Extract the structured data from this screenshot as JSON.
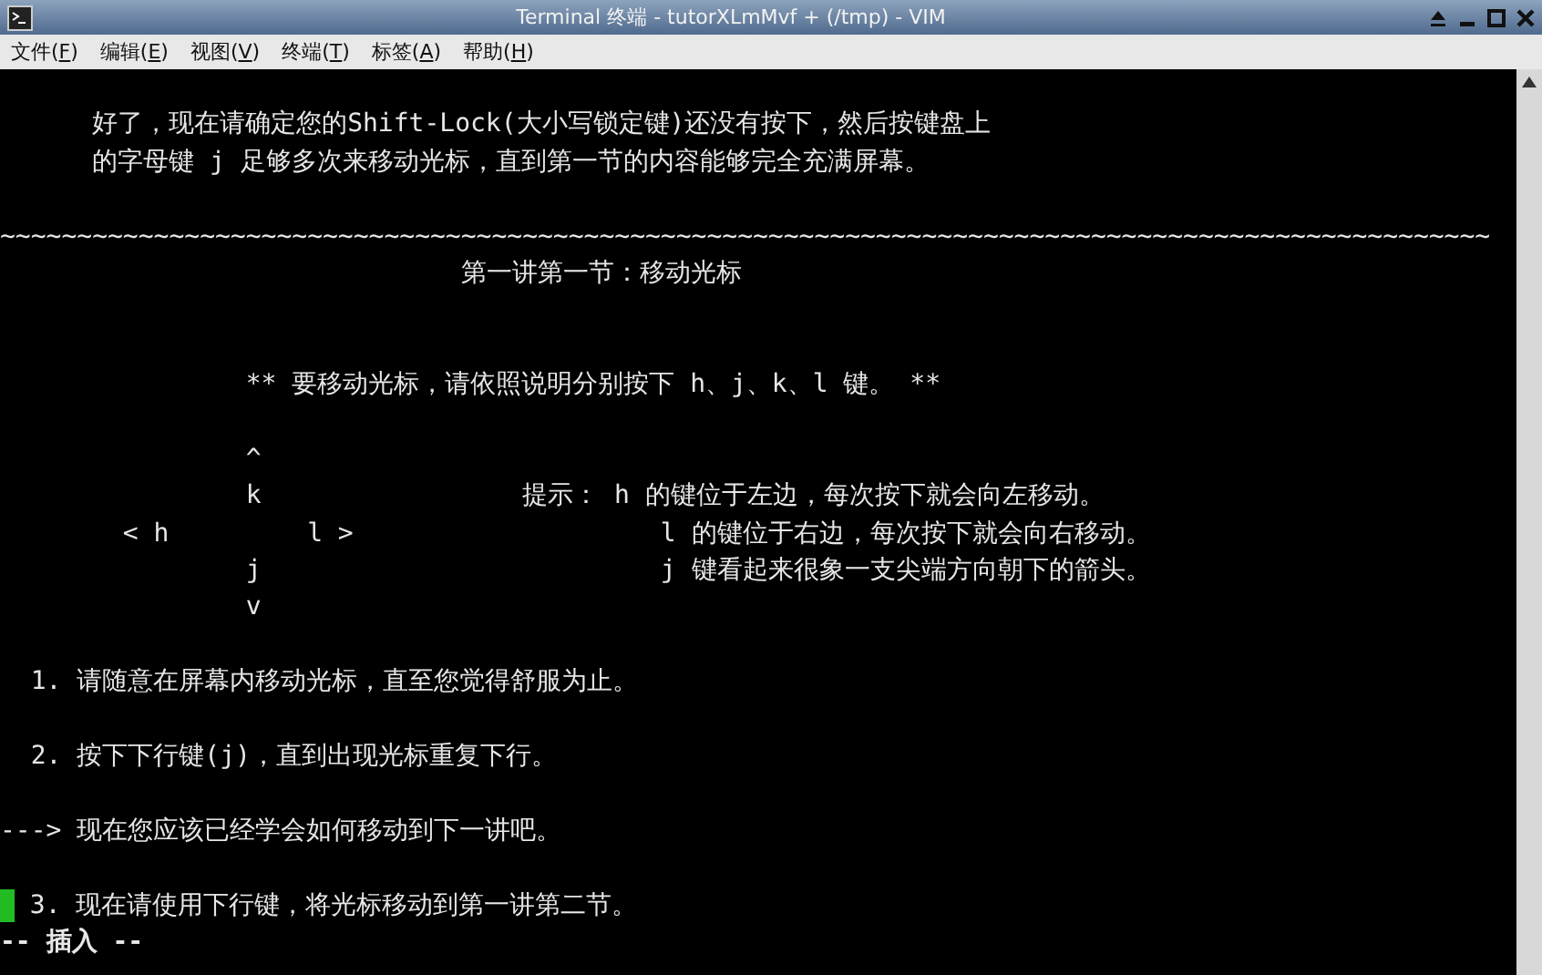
{
  "window": {
    "title": "Terminal 终端 - tutorXLmMvf + (/tmp) - VIM"
  },
  "menu": [
    "文件(F)",
    "编辑(E)",
    "视图(V)",
    "终端(T)",
    "标签(A)",
    "帮助(H)"
  ],
  "terminal": {
    "lines": [
      {
        "kind": "blank"
      },
      {
        "kind": "text",
        "text": "      好了，现在请确定您的Shift-Lock(大小写锁定键)还没有按下，然后按键盘上"
      },
      {
        "kind": "text",
        "text": "      的字母键 j 足够多次来移动光标，直到第一节的内容能够完全充满屏幕。"
      },
      {
        "kind": "blank"
      },
      {
        "kind": "text",
        "text": "~~~~~~~~~~~~~~~~~~~~~~~~~~~~~~~~~~~~~~~~~~~~~~~~~~~~~~~~~~~~~~~~~~~~~~~~~~~~~~~~~~~~~~~~~~~~~~~~~"
      },
      {
        "kind": "text",
        "text": "                              第一讲第一节：移动光标"
      },
      {
        "kind": "blank"
      },
      {
        "kind": "blank"
      },
      {
        "kind": "text",
        "text": "                ** 要移动光标，请依照说明分别按下 h、j、k、l 键。 **"
      },
      {
        "kind": "blank"
      },
      {
        "kind": "text",
        "text": "                ^"
      },
      {
        "kind": "text",
        "text": "                k                 提示： h 的键位于左边，每次按下就会向左移动。"
      },
      {
        "kind": "text",
        "text": "        < h         l >                    l 的键位于右边，每次按下就会向右移动。"
      },
      {
        "kind": "text",
        "text": "                j                          j 键看起来很象一支尖端方向朝下的箭头。"
      },
      {
        "kind": "text",
        "text": "                v"
      },
      {
        "kind": "blank"
      },
      {
        "kind": "text",
        "text": "  1. 请随意在屏幕内移动光标，直至您觉得舒服为止。"
      },
      {
        "kind": "blank"
      },
      {
        "kind": "text",
        "text": "  2. 按下下行键(j)，直到出现光标重复下行。"
      },
      {
        "kind": "blank"
      },
      {
        "kind": "text",
        "text": "---> 现在您应该已经学会如何移动到下一讲吧。"
      },
      {
        "kind": "blank"
      },
      {
        "kind": "cursor",
        "text": " 3. 现在请使用下行键，将光标移动到第一讲第二节。"
      },
      {
        "kind": "status",
        "text": "-- 插入 --"
      }
    ]
  }
}
